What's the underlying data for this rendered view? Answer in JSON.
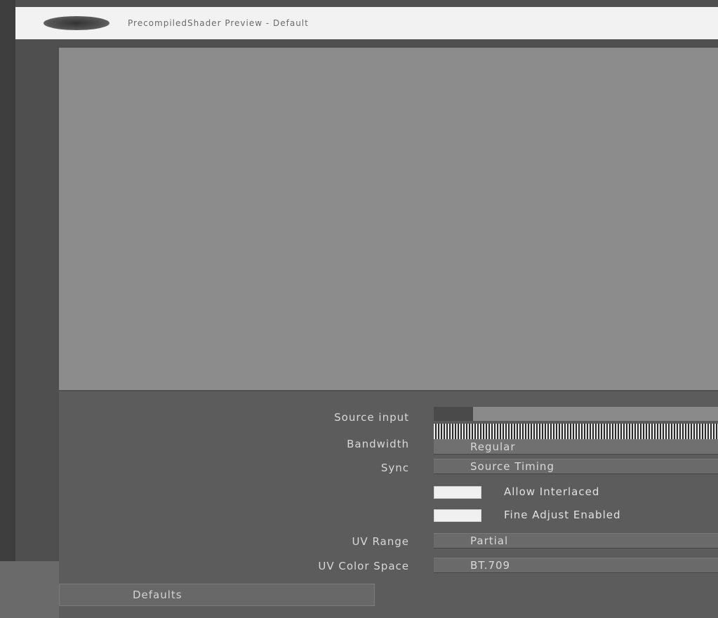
{
  "title_bar": {
    "title": "PrecompiledShader Preview - Default"
  },
  "settings": {
    "source_input_label": "Source input",
    "bandwidth_label": "Bandwidth",
    "bandwidth_value": "Regular",
    "sync_label": "Sync",
    "sync_value": "Source Timing",
    "allow_interlaced_label": "Allow Interlaced",
    "fine_adjust_label": "Fine Adjust Enabled",
    "uv_range_label": "UV Range",
    "uv_range_value": "Partial",
    "uv_color_space_label": "UV Color Space",
    "uv_color_space_value": "BT.709",
    "defaults_button": "Defaults"
  },
  "icons": {
    "logo": "app-logo-icon"
  }
}
